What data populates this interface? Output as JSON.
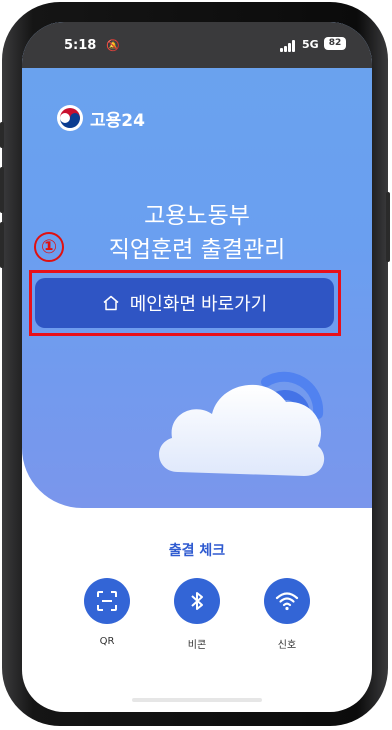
{
  "status": {
    "time": "5:18",
    "network": "5G",
    "battery": "82"
  },
  "brand": {
    "name": "고용24"
  },
  "hero": {
    "title_line1": "고용노동부",
    "title_line2": "직업훈련 출결관리",
    "annotation_number": "①",
    "main_button_label": "메인화면 바로가기"
  },
  "attendance": {
    "heading": "출결 체크",
    "options": [
      {
        "label": "QR",
        "icon": "qr-scan-icon"
      },
      {
        "label": "비콘",
        "icon": "bluetooth-icon"
      },
      {
        "label": "신호",
        "icon": "wifi-icon"
      }
    ]
  },
  "colors": {
    "hero_blue": "#6aa3ee",
    "button_blue": "#2f55c4",
    "highlight_red": "#e8101a"
  }
}
